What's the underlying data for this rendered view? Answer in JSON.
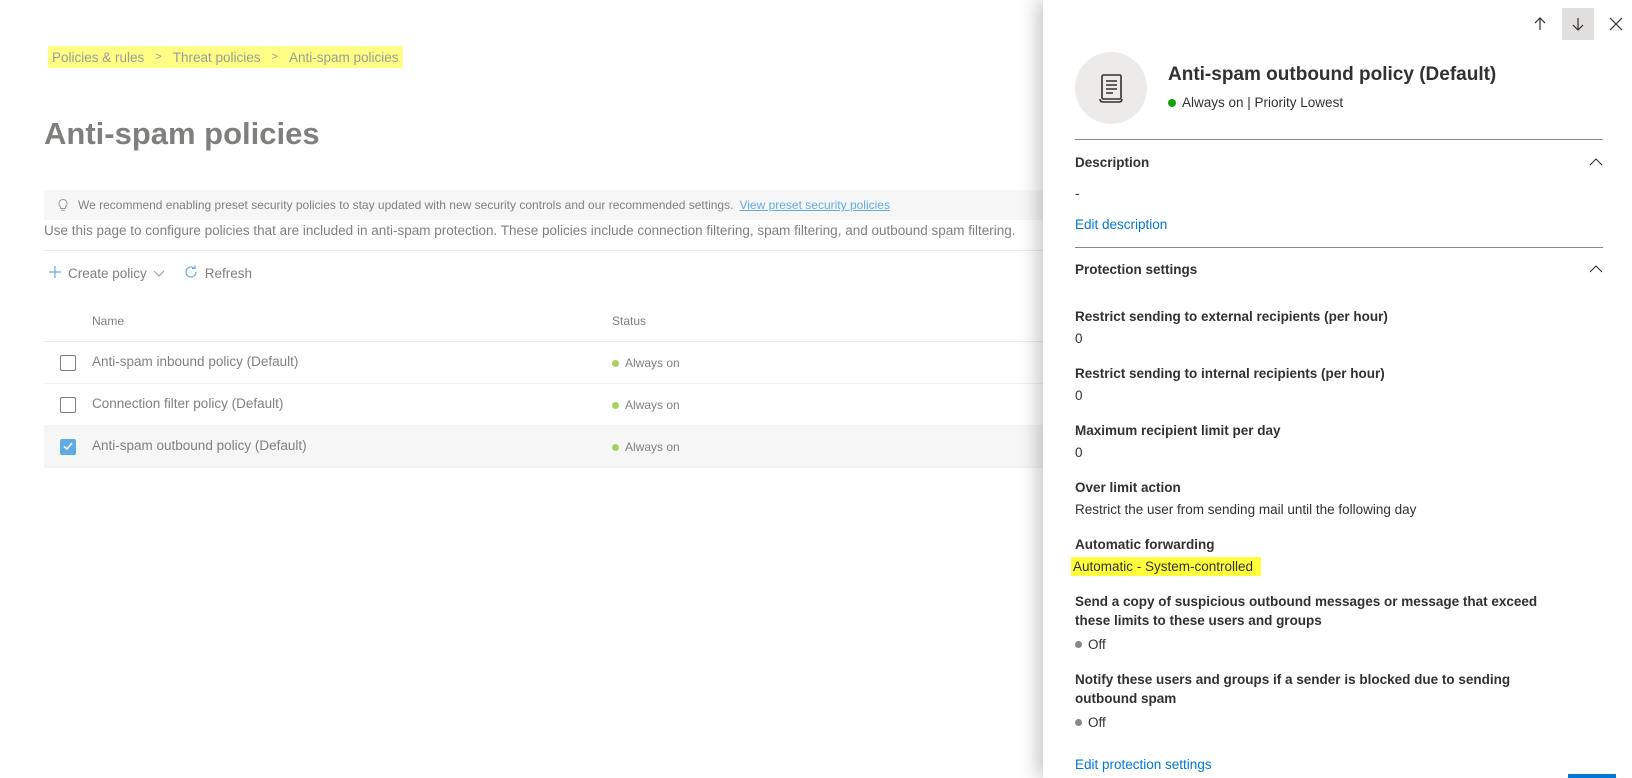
{
  "breadcrumb": {
    "items": [
      "Policies & rules",
      "Threat policies",
      "Anti-spam policies"
    ],
    "separator": ">"
  },
  "page": {
    "title": "Anti-spam policies",
    "banner_text": "We recommend enabling preset security policies to stay updated with new security controls and our recommended settings.",
    "banner_link": "View preset security policies",
    "intro": "Use this page to configure policies that are included in anti-spam protection. These policies include connection filtering, spam filtering, and outbound spam filtering."
  },
  "toolbar": {
    "create_label": "Create policy",
    "refresh_label": "Refresh"
  },
  "table": {
    "columns": [
      "Name",
      "Status"
    ],
    "rows": [
      {
        "name": "Anti-spam inbound policy (Default)",
        "status": "Always on",
        "selected": false
      },
      {
        "name": "Connection filter policy (Default)",
        "status": "Always on",
        "selected": false
      },
      {
        "name": "Anti-spam outbound policy (Default)",
        "status": "Always on",
        "selected": true
      }
    ]
  },
  "panel": {
    "title": "Anti-spam outbound policy (Default)",
    "subtitle": "Always on | Priority Lowest",
    "description": {
      "heading": "Description",
      "value": "-",
      "edit_link": "Edit description"
    },
    "protection": {
      "heading": "Protection settings",
      "settings": [
        {
          "label": "Restrict sending to external recipients (per hour)",
          "value": "0"
        },
        {
          "label": "Restrict sending to internal recipients (per hour)",
          "value": "0"
        },
        {
          "label": "Maximum recipient limit per day",
          "value": "0"
        },
        {
          "label": "Over limit action",
          "value": "Restrict the user from sending mail until the following day"
        },
        {
          "label": "Automatic forwarding",
          "value": "Automatic - System-controlled"
        },
        {
          "label": "Send a copy of suspicious outbound messages or message that exceed these limits to these users and groups",
          "value": "Off"
        },
        {
          "label": "Notify these users and groups if a sender is blocked due to sending outbound spam",
          "value": "Off"
        }
      ],
      "edit_link": "Edit protection settings"
    }
  },
  "colors": {
    "highlight": "#ffff3c",
    "status_on": "#6bb700",
    "status_off": "#8a8886",
    "link": "#0078d4"
  }
}
